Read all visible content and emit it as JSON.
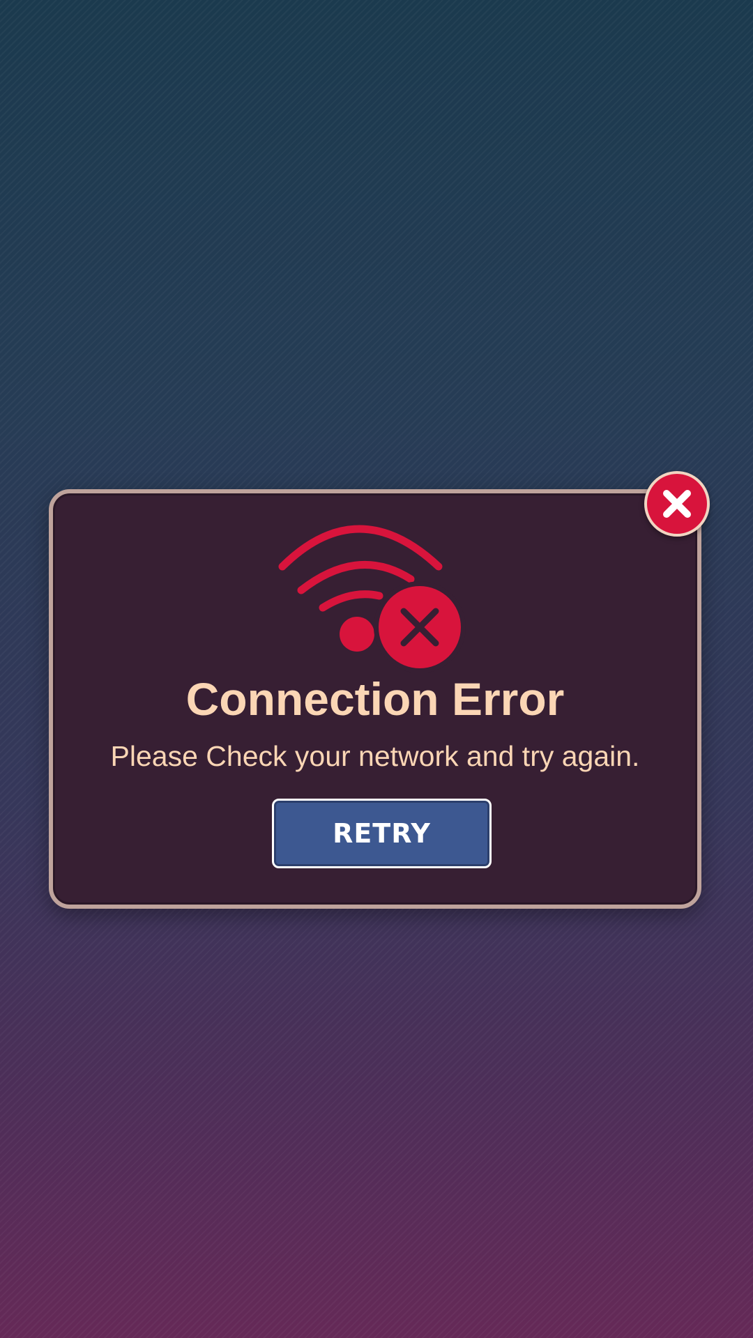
{
  "dialog": {
    "title": "Connection Error",
    "message": "Please Check your network and try again.",
    "retry_label": "RETRY"
  },
  "icons": {
    "main": "wifi-off-icon",
    "close": "close-icon"
  },
  "colors": {
    "background_top": "#1b3a4e",
    "background_bottom": "#652957",
    "dialog_bg": "#371f33",
    "dialog_border": "#bfa39c",
    "accent_red": "#d8143c",
    "text_peach": "#fbd6b5",
    "button_blue": "#3d5891"
  }
}
